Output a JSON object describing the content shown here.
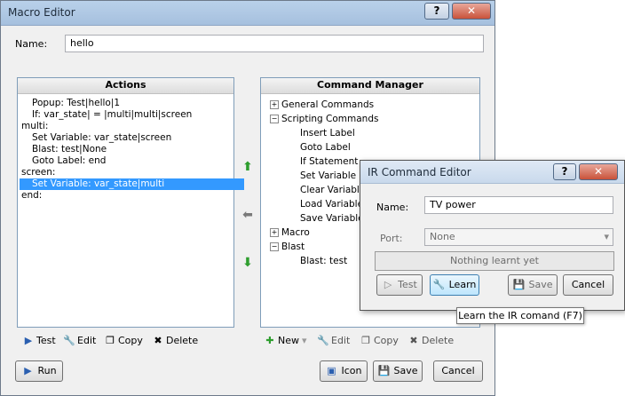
{
  "main_window": {
    "title": "Macro Editor",
    "help_glyph": "?",
    "close_glyph": "✕",
    "name_label": "Name:",
    "name_value": "hello"
  },
  "actions": {
    "header": "Actions",
    "lines": [
      "Popup: Test|hello|1",
      "If: var_state| = |multi|multi|screen",
      "multi:",
      "Set Variable: var_state|screen",
      "Blast: test|None",
      "Goto Label: end",
      "screen:",
      "Set Variable: var_state|multi",
      "end:"
    ],
    "selected_index": 7,
    "toolbar": {
      "test": "Test",
      "edit": "Edit",
      "copy": "Copy",
      "delete": "Delete"
    }
  },
  "command_manager": {
    "header": "Command Manager",
    "tree": {
      "general": "General Commands",
      "scripting": "Scripting Commands",
      "scripting_children": [
        "Insert Label",
        "Goto Label",
        "If Statement",
        "Set Variable",
        "Clear Variable",
        "Load Variable",
        "Save Variable"
      ],
      "macro": "Macro",
      "blast": "Blast",
      "blast_children": [
        "Blast: test"
      ]
    },
    "toolbar": {
      "new": "New",
      "edit": "Edit",
      "copy": "Copy",
      "delete": "Delete"
    }
  },
  "bottom_buttons": {
    "run": "Run",
    "icon": "Icon",
    "save": "Save",
    "cancel": "Cancel"
  },
  "ir_dialog": {
    "title": "IR Command Editor",
    "help_glyph": "?",
    "close_glyph": "✕",
    "name_label": "Name:",
    "name_value": "TV power",
    "port_label": "Port:",
    "port_value": "None",
    "status": "Nothing learnt yet",
    "test": "Test",
    "learn": "Learn",
    "save": "Save",
    "cancel": "Cancel"
  },
  "tooltip": "Learn the IR comand (F7)",
  "colors": {
    "selection": "#3399ff",
    "arrow_green": "#2e9e2e",
    "arrow_gray": "#7a7a7a"
  }
}
